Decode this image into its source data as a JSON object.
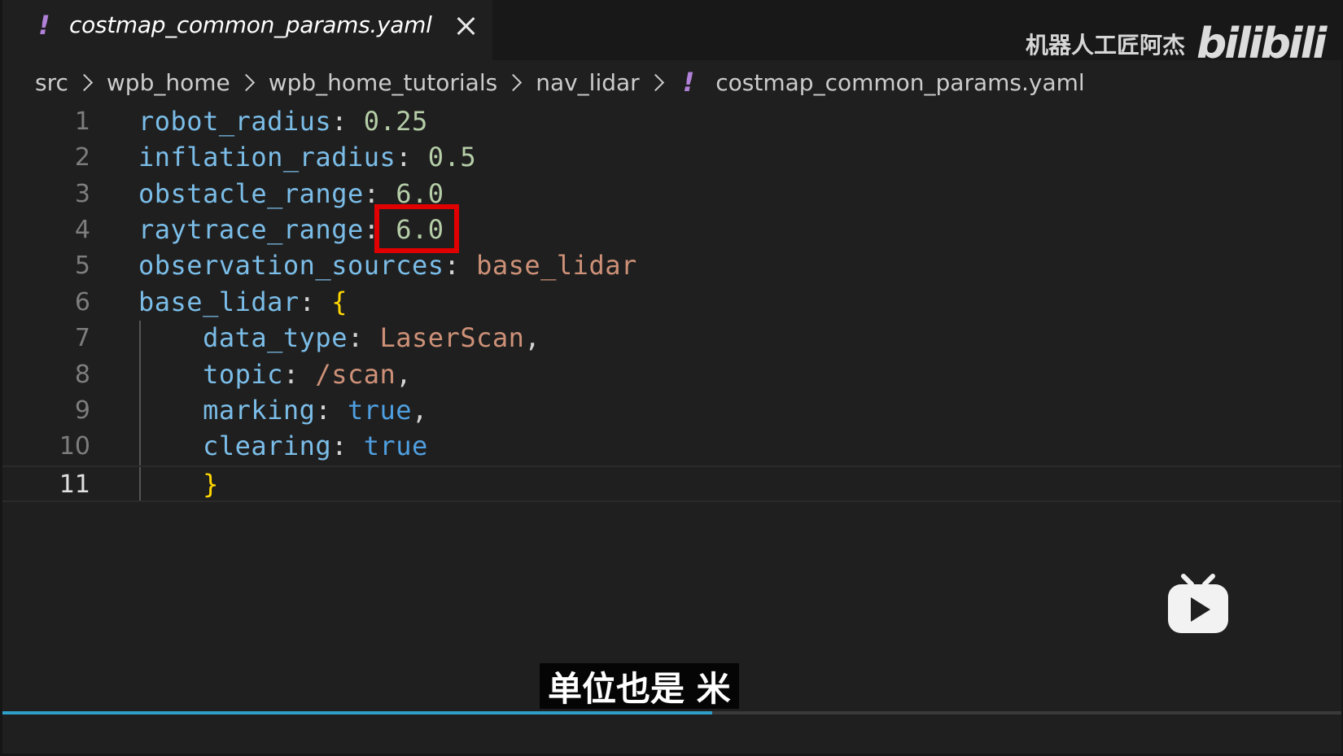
{
  "tab": {
    "icon": "yaml-exclamation-icon",
    "icon_glyph": "!",
    "title": "costmap_common_params.yaml",
    "close_icon": "close-icon"
  },
  "watermark": {
    "author": "机器人工匠阿杰",
    "logo": "bilibili"
  },
  "breadcrumb": {
    "items": [
      "src",
      "wpb_home",
      "wpb_home_tutorials",
      "nav_lidar"
    ],
    "file_icon_glyph": "!",
    "file": "costmap_common_params.yaml"
  },
  "editor": {
    "line_numbers": [
      "1",
      "2",
      "3",
      "4",
      "5",
      "6",
      "7",
      "8",
      "9",
      "10",
      "11"
    ],
    "current_line": 11,
    "highlighted_value": "6.0",
    "highlight_color": "#e00000",
    "lines": [
      {
        "key": "robot_radius",
        "sep": ": ",
        "value": "0.25",
        "value_kind": "number"
      },
      {
        "key": "inflation_radius",
        "sep": ": ",
        "value": "0.5",
        "value_kind": "number"
      },
      {
        "key": "obstacle_range",
        "sep": ": ",
        "value": "6.0",
        "value_kind": "number"
      },
      {
        "key": "raytrace_range",
        "sep": ": ",
        "value": "6.0",
        "value_kind": "number"
      },
      {
        "key": "observation_sources",
        "sep": ": ",
        "value": "base_lidar",
        "value_kind": "string"
      },
      {
        "key": "base_lidar",
        "sep": ": ",
        "value": "{",
        "value_kind": "bracket"
      },
      {
        "key": "data_type",
        "sep": ": ",
        "value": "LaserScan",
        "value_kind": "string",
        "trail": ","
      },
      {
        "key": "topic",
        "sep": ": ",
        "value": "/scan",
        "value_kind": "string",
        "trail": ","
      },
      {
        "key": "marking",
        "sep": ": ",
        "value": "true",
        "value_kind": "bool",
        "trail": ","
      },
      {
        "key": "clearing",
        "sep": ": ",
        "value": "true",
        "value_kind": "bool"
      },
      {
        "value": "}",
        "value_kind": "bracket"
      }
    ]
  },
  "video": {
    "subtitle": "单位也是 米",
    "progress": 0.53,
    "play_badge_icon": "bilibili-tv-play-icon"
  }
}
